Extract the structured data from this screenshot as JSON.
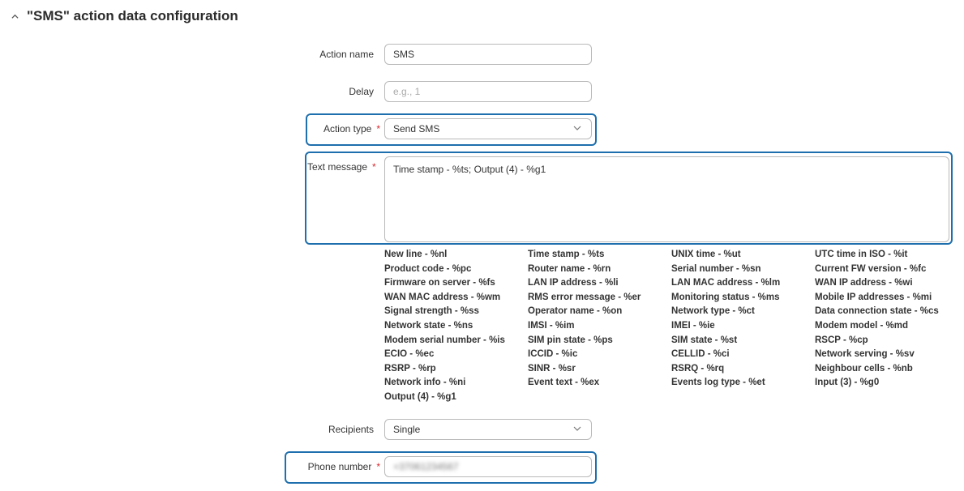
{
  "section": {
    "title": "\"SMS\" action data configuration"
  },
  "action_name": {
    "label": "Action name",
    "value": "SMS"
  },
  "delay": {
    "label": "Delay",
    "placeholder": "e.g., 1"
  },
  "action_type": {
    "label": "Action type",
    "required": "*",
    "value": "Send SMS"
  },
  "text_message": {
    "label": "Text message",
    "required": "*",
    "value": "Time stamp - %ts; Output (4) - %g1"
  },
  "variables": [
    "New line - %nl",
    "Time stamp - %ts",
    "UNIX time - %ut",
    "UTC time in ISO - %it",
    "Product code - %pc",
    "Router name - %rn",
    "Serial number - %sn",
    "Current FW version - %fc",
    "Firmware on server - %fs",
    "LAN IP address - %li",
    "LAN MAC address - %lm",
    "WAN IP address - %wi",
    "WAN MAC address - %wm",
    "RMS error message - %er",
    "Monitoring status - %ms",
    "Mobile IP addresses - %mi",
    "Signal strength - %ss",
    "Operator name - %on",
    "Network type - %ct",
    "Data connection state - %cs",
    "Network state - %ns",
    "IMSI - %im",
    "IMEI - %ie",
    "Modem model - %md",
    "Modem serial number - %is",
    "SIM pin state - %ps",
    "SIM state - %st",
    "RSCP - %cp",
    "ECIO - %ec",
    "ICCID - %ic",
    "CELLID - %ci",
    "Network serving - %sv",
    "RSRP - %rp",
    "SINR - %sr",
    "RSRQ - %rq",
    "Neighbour cells - %nb",
    "Network info - %ni",
    "Event text - %ex",
    "Events log type - %et",
    "Input (3) - %g0",
    "Output (4) - %g1"
  ],
  "recipients": {
    "label": "Recipients",
    "value": "Single"
  },
  "phone_number": {
    "label": "Phone number",
    "required": "*",
    "value": "+37061234567"
  },
  "colors": {
    "highlight": "#1e6fae",
    "required": "#d9262c",
    "border": "#b9b9b9"
  },
  "icons": {
    "collapse": "chevron-up-icon",
    "dropdown": "chevron-down-icon"
  }
}
